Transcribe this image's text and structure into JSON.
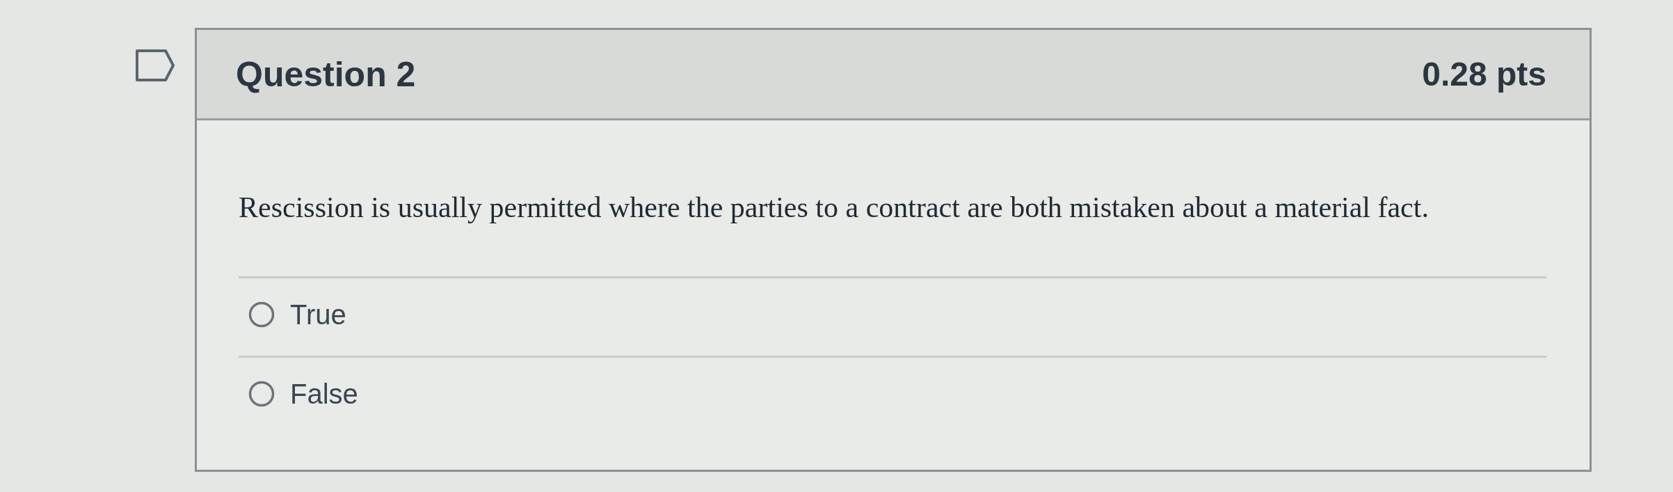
{
  "question": {
    "flagged": false,
    "title": "Question 2",
    "points": "0.28 pts",
    "text": "Rescission is usually permitted where the parties to a contract are both mistaken about a material fact.",
    "answers": [
      {
        "label": "True",
        "selected": false
      },
      {
        "label": "False",
        "selected": false
      }
    ]
  }
}
